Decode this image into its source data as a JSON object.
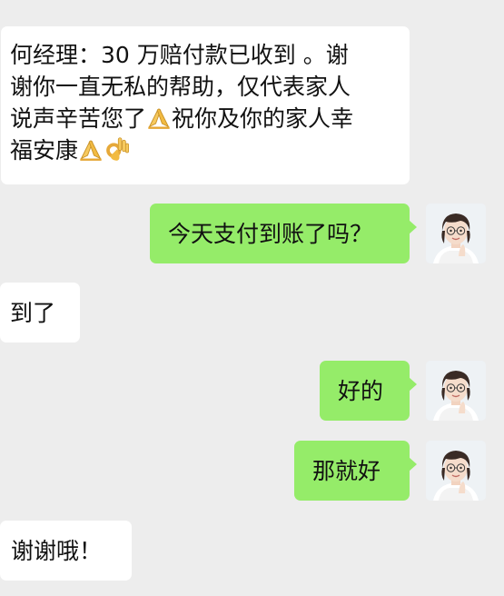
{
  "chat": {
    "messages": [
      {
        "direction": "incoming",
        "lines": [
          "何经理：30 万赔付款已收到 。谢",
          "谢你一直无私的帮助，仅代表家人",
          "说声辛苦您了",
          "祝你及你的家人幸",
          "福安康"
        ],
        "emojis": [
          "folded-hands-emoji",
          "folded-hands-emoji",
          "ok-hand-emoji"
        ]
      },
      {
        "direction": "outgoing",
        "text": "今天支付到账了吗？"
      },
      {
        "direction": "incoming",
        "text": "到了"
      },
      {
        "direction": "outgoing",
        "text": "好的"
      },
      {
        "direction": "outgoing",
        "text": "那就好"
      },
      {
        "direction": "incoming",
        "text": "谢谢哦！"
      }
    ]
  },
  "colors": {
    "background": "#ededed",
    "incoming_bubble": "#ffffff",
    "outgoing_bubble": "#95ec69",
    "text": "#111111"
  }
}
